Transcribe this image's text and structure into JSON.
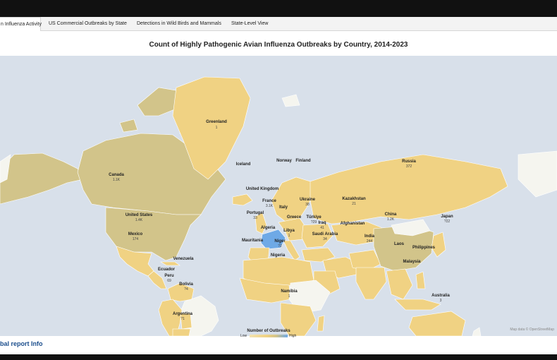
{
  "tabs": [
    {
      "label": "n Influenza Activity",
      "active": true
    },
    {
      "label": "US Commercial Outbreaks by State",
      "active": false
    },
    {
      "label": "Detections in Wild Birds and Mammals",
      "active": false
    },
    {
      "label": "State-Level View",
      "active": false
    }
  ],
  "map": {
    "title": "Count of Highly Pathogenic Avian Influenza Outbreaks by Country, 2014-2023",
    "attribution": "Map data © OpenStreetMap",
    "legend": {
      "title": "Number of Outbreaks",
      "low": "Low",
      "high": "High"
    },
    "colors": {
      "ocean": "#d8e0ea",
      "low": "#f3e3b0",
      "mid": "#f0d283",
      "olive": "#d2c48a",
      "high": "#6ea9e6",
      "nodata": "#f5f5ef"
    },
    "countries": [
      {
        "name": "Greenland",
        "value": "1"
      },
      {
        "name": "Canada",
        "value": "1.1K"
      },
      {
        "name": "United States",
        "value": "1.4K"
      },
      {
        "name": "Mexico",
        "value": "174"
      },
      {
        "name": "Iceland",
        "value": ""
      },
      {
        "name": "Norway",
        "value": ""
      },
      {
        "name": "Finland",
        "value": ""
      },
      {
        "name": "Russia",
        "value": "372"
      },
      {
        "name": "United Kingdom",
        "value": ""
      },
      {
        "name": "France",
        "value": "3.1K"
      },
      {
        "name": "Italy",
        "value": ""
      },
      {
        "name": "Portugal",
        "value": "33"
      },
      {
        "name": "Ukraine",
        "value": "38"
      },
      {
        "name": "Kazakhstan",
        "value": "21"
      },
      {
        "name": "Greece",
        "value": ""
      },
      {
        "name": "Türkiye",
        "value": "?29"
      },
      {
        "name": "China",
        "value": "1.2K"
      },
      {
        "name": "Japan",
        "value": "?22"
      },
      {
        "name": "Algeria",
        "value": ""
      },
      {
        "name": "Libya",
        "value": "1"
      },
      {
        "name": "Iraq",
        "value": "41"
      },
      {
        "name": "Afghanistan",
        "value": ""
      },
      {
        "name": "Saudi Arabia",
        "value": "34"
      },
      {
        "name": "India",
        "value": "244"
      },
      {
        "name": "Mauritania",
        "value": ""
      },
      {
        "name": "Niger",
        "value": "?2"
      },
      {
        "name": "Laos",
        "value": ""
      },
      {
        "name": "Philippines",
        "value": ""
      },
      {
        "name": "Venezuela",
        "value": ""
      },
      {
        "name": "Nigeria",
        "value": ""
      },
      {
        "name": "Ecuador",
        "value": ""
      },
      {
        "name": "Peru",
        "value": "69"
      },
      {
        "name": "Malaysia",
        "value": ""
      },
      {
        "name": "Bolivia",
        "value": "?4"
      },
      {
        "name": "Namibia",
        "value": "1"
      },
      {
        "name": "Australia",
        "value": "3"
      },
      {
        "name": "Argentina",
        "value": "?1"
      }
    ]
  },
  "footer": {
    "report_link": "bal report Info"
  }
}
